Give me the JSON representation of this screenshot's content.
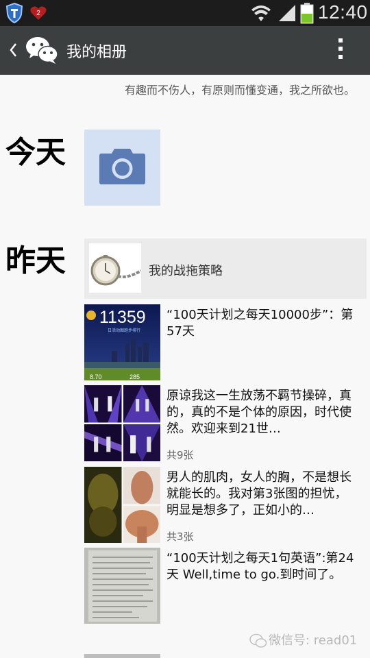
{
  "status_bar": {
    "notification_badge": "2",
    "time": "12:40"
  },
  "header": {
    "title": "我的相册"
  },
  "signature": "有趣而不伤人，有原则而懂变通，我之所欲也。",
  "days": {
    "today": "今天",
    "yesterday": "昨天"
  },
  "shared_link": {
    "title": "我的战拖策略"
  },
  "posts": [
    {
      "text": "“100天计划之每天10000步”：第57天",
      "image_digits": "11359",
      "image_caption": "日活动图跑步排行",
      "image_bottom": [
        "8.70",
        "285"
      ]
    },
    {
      "text": "原谅我这一生放荡不羁节操碎，真的，真的不是个体的原因，时代使然。欢迎来到21世…",
      "count": "共9张"
    },
    {
      "text": "男人的肌肉，女人的胸，不是想长就能长的。我对第3张图的担忧，明显是想多了，正如小的…",
      "count": "共3张"
    },
    {
      "text": "“100天计划之每天1句英语”:第24天 Well,time to go.到时间了。"
    }
  ],
  "watermark": "微信号: read01",
  "colors": {
    "action_bar": "#3c3f40",
    "status_bar": "#1c1c1c",
    "upload_tile": "#d4e0f3",
    "camera": "#5b7bb4",
    "battery": "#7bc62d"
  }
}
